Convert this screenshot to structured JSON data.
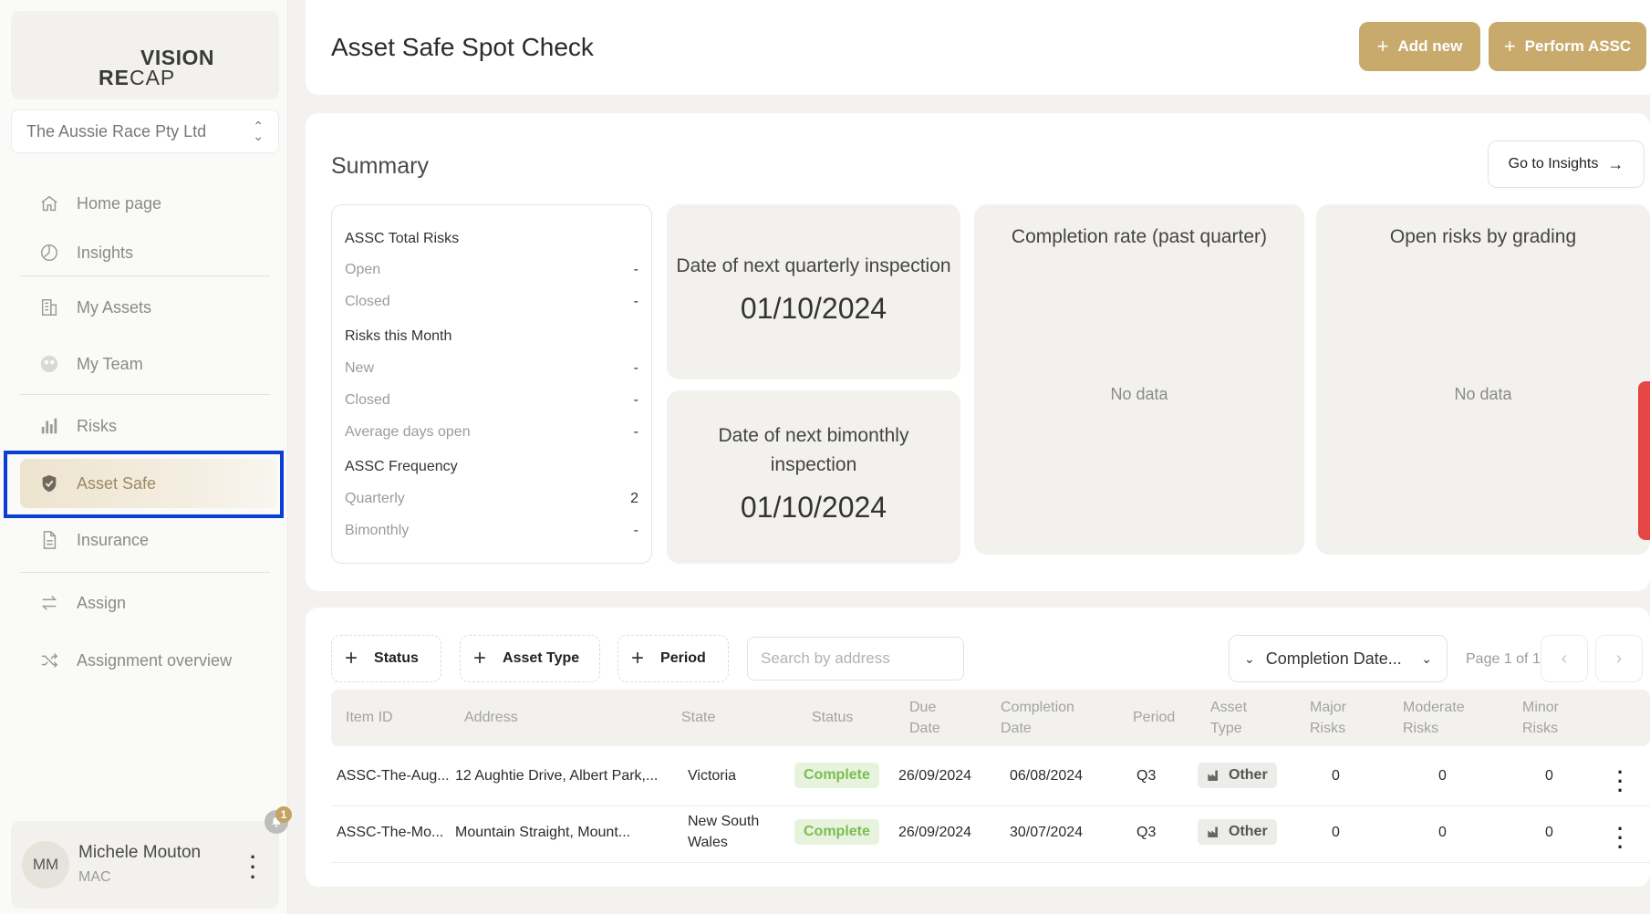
{
  "logo": {
    "line1": "VISION",
    "line2_bold": "RE",
    "line2_rest": "CAP"
  },
  "org": {
    "selected": "The Aussie Race Pty Ltd"
  },
  "nav": {
    "home": "Home page",
    "insights": "Insights",
    "assets": "My Assets",
    "team": "My Team",
    "risks": "Risks",
    "asset_safe": "Asset Safe",
    "insurance": "Insurance",
    "assign": "Assign",
    "assignment_overview": "Assignment overview"
  },
  "user": {
    "initials": "MM",
    "name": "Michele Mouton",
    "role": "MAC",
    "notifications": "1"
  },
  "header": {
    "title": "Asset Safe Spot Check",
    "add_new": "Add new",
    "perform": "Perform ASSC"
  },
  "summary": {
    "title": "Summary",
    "go_to_insights": "Go to Insights",
    "risks_card": {
      "total_heading": "ASSC Total Risks",
      "open_label": "Open",
      "open_value": "-",
      "closed_label": "Closed",
      "closed_value": "-",
      "month_heading": "Risks this Month",
      "new_label": "New",
      "new_value": "-",
      "month_closed_label": "Closed",
      "month_closed_value": "-",
      "avg_days_label": "Average days open",
      "avg_days_value": "-",
      "freq_heading": "ASSC Frequency",
      "quarterly_label": "Quarterly",
      "quarterly_value": "2",
      "bimonthly_label": "Bimonthly",
      "bimonthly_value": "-"
    },
    "quarterly": {
      "label": "Date of next quarterly inspection",
      "value": "01/10/2024"
    },
    "bimonthly": {
      "label": "Date of next bimonthly inspection",
      "value": "01/10/2024"
    },
    "completion": {
      "label": "Completion rate (past quarter)",
      "empty": "No data"
    },
    "grading": {
      "label": "Open risks by grading",
      "empty": "No data"
    }
  },
  "filters": {
    "status": "Status",
    "asset_type": "Asset Type",
    "period": "Period",
    "search_placeholder": "Search by address",
    "sort": "Completion Date...",
    "page": "Page 1 of 1"
  },
  "table": {
    "headers": {
      "item_id": "Item ID",
      "address": "Address",
      "state": "State",
      "status": "Status",
      "due_1": "Due",
      "due_2": "Date",
      "comp_1": "Completion",
      "comp_2": "Date",
      "period": "Period",
      "type_1": "Asset",
      "type_2": "Type",
      "major_1": "Major",
      "major_2": "Risks",
      "moderate_1": "Moderate",
      "moderate_2": "Risks",
      "minor_1": "Minor",
      "minor_2": "Risks"
    },
    "rows": [
      {
        "id": "ASSC-The-Aug...",
        "address": "12 Aughtie Drive, Albert Park,...",
        "state_1": "Victoria",
        "state_2": "",
        "status": "Complete",
        "due": "26/09/2024",
        "completed": "06/08/2024",
        "period": "Q3",
        "type": "Other",
        "major": "0",
        "moderate": "0",
        "minor": "0"
      },
      {
        "id": "ASSC-The-Mo...",
        "address": "Mountain Straight, Mount...",
        "state_1": "New South",
        "state_2": "Wales",
        "status": "Complete",
        "due": "26/09/2024",
        "completed": "30/07/2024",
        "period": "Q3",
        "type": "Other",
        "major": "0",
        "moderate": "0",
        "minor": "0"
      }
    ]
  }
}
